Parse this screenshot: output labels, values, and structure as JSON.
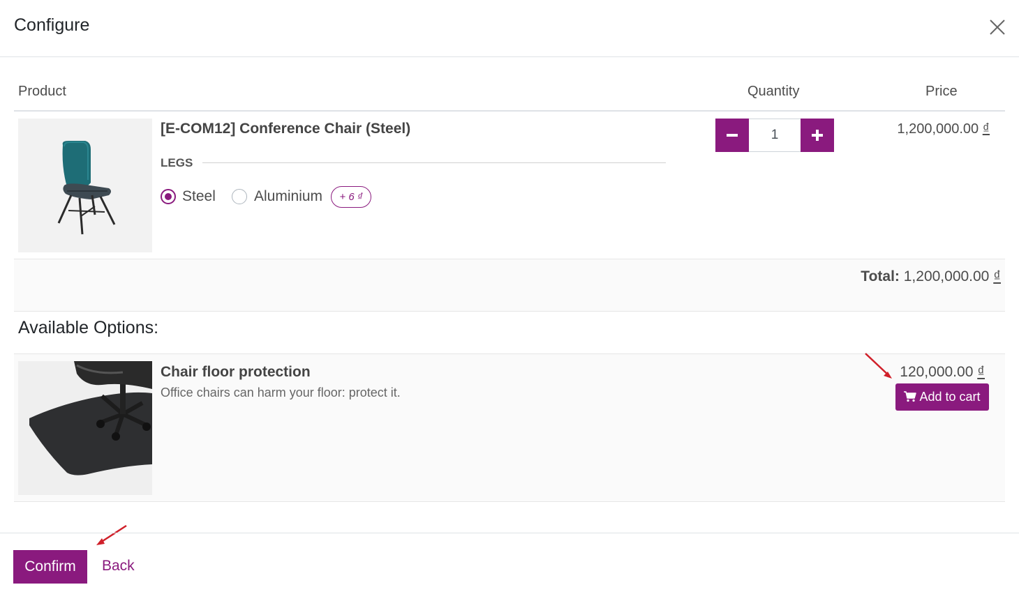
{
  "header": {
    "title": "Configure"
  },
  "table": {
    "col_product": "Product",
    "col_quantity": "Quantity",
    "col_price": "Price"
  },
  "product": {
    "name": "[E-COM12] Conference Chair (Steel)",
    "attribute_label": "LEGS",
    "options": [
      {
        "label": "Steel",
        "selected": true
      },
      {
        "label": "Aluminium",
        "selected": false
      }
    ],
    "extra_price_badge": "+ 6 ₫",
    "quantity": "1",
    "price": "1,200,000.00",
    "currency": "₫"
  },
  "total": {
    "label": "Total:",
    "value": "1,200,000.00",
    "currency": "₫"
  },
  "options_section": {
    "title": "Available Options:",
    "items": [
      {
        "name": "Chair floor protection",
        "description": "Office chairs can harm your floor: protect it.",
        "price": "120,000.00",
        "currency": "₫",
        "add_label": "Add to cart"
      }
    ]
  },
  "footer": {
    "confirm_label": "Confirm",
    "back_label": "Back"
  },
  "colors": {
    "accent": "#8a1a7e",
    "annotation": "#d0202a"
  },
  "icons": {
    "close": "close-icon",
    "cart": "shopping-cart-icon",
    "minus": "minus-icon",
    "plus": "plus-icon"
  }
}
